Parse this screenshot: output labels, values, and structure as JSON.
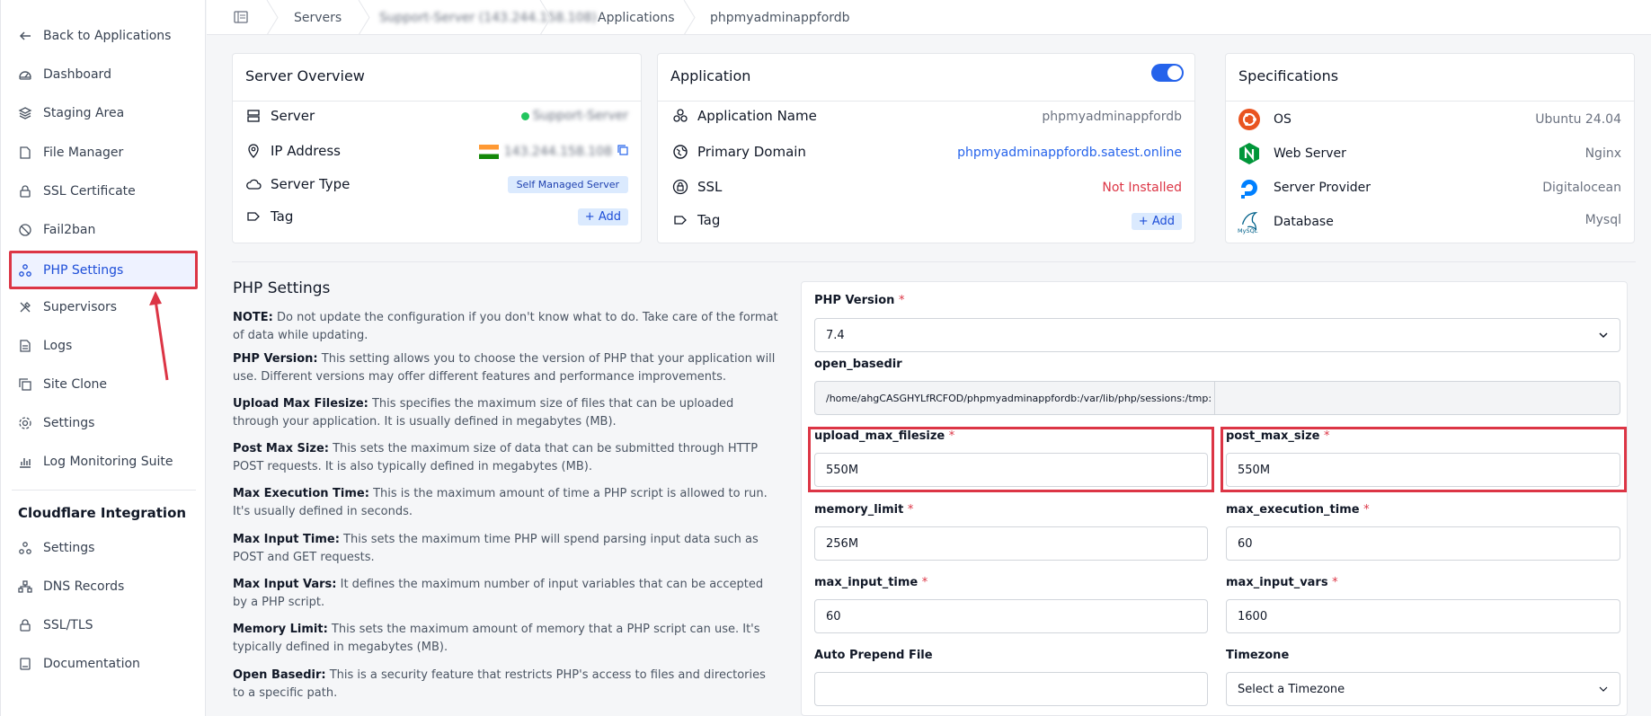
{
  "sidebar": {
    "back": "Back to Applications",
    "items": [
      {
        "label": "Dashboard",
        "icon": "dashboard-icon"
      },
      {
        "label": "Staging Area",
        "icon": "layers-icon"
      },
      {
        "label": "File Manager",
        "icon": "file-icon"
      },
      {
        "label": "SSL Certificate",
        "icon": "lock-icon"
      },
      {
        "label": "Fail2ban",
        "icon": "ban-icon"
      },
      {
        "label": "PHP Settings",
        "icon": "nodes-icon"
      },
      {
        "label": "Supervisors",
        "icon": "tools-icon"
      },
      {
        "label": "Logs",
        "icon": "document-icon"
      },
      {
        "label": "Site Clone",
        "icon": "copy-icon"
      },
      {
        "label": "Settings",
        "icon": "gear-icon"
      },
      {
        "label": "Log Monitoring Suite",
        "icon": "chart-icon"
      }
    ],
    "cloudflare_title": "Cloudflare Integration",
    "cloudflare_items": [
      {
        "label": "Settings",
        "icon": "nodes-icon"
      },
      {
        "label": "DNS Records",
        "icon": "network-icon"
      },
      {
        "label": "SSL/TLS",
        "icon": "lock-icon"
      },
      {
        "label": "Documentation",
        "icon": "book-icon"
      }
    ]
  },
  "breadcrumb": {
    "servers": "Servers",
    "server_name": "Support-Server (143.244.158.108)",
    "applications": "Applications",
    "app": "phpmyadminappfordb"
  },
  "server_overview": {
    "title": "Server Overview",
    "server_label": "Server",
    "server_value": "Support-Server",
    "ip_label": "IP Address",
    "ip_value": "143.244.158.108",
    "type_label": "Server Type",
    "type_value": "Self Managed Server",
    "tag_label": "Tag",
    "add_label": "+ Add"
  },
  "application": {
    "title": "Application",
    "name_label": "Application Name",
    "name_value": "phpmyadminappfordb",
    "domain_label": "Primary Domain",
    "domain_value": "phpmyadminappfordb.satest.online",
    "ssl_label": "SSL",
    "ssl_value": "Not Installed",
    "tag_label": "Tag",
    "add_label": "+ Add"
  },
  "specifications": {
    "title": "Specifications",
    "os_label": "OS",
    "os_value": "Ubuntu 24.04",
    "web_label": "Web Server",
    "web_value": "Nginx",
    "provider_label": "Server Provider",
    "provider_value": "Digitalocean",
    "db_label": "Database",
    "db_value": "Mysql"
  },
  "php": {
    "title": "PHP Settings",
    "descriptions": [
      {
        "key": "NOTE:",
        "text": " Do not update the configuration if you don't know what to do. Take care of the format of data while updating."
      },
      {
        "key": "PHP Version:",
        "text": " This setting allows you to choose the version of PHP that your application will use. Different versions may offer different features and performance improvements."
      },
      {
        "key": "Upload Max Filesize:",
        "text": " This specifies the maximum size of files that can be uploaded through your application. It is usually defined in megabytes (MB)."
      },
      {
        "key": "Post Max Size:",
        "text": " This sets the maximum size of data that can be submitted through HTTP POST requests. It is also typically defined in megabytes (MB)."
      },
      {
        "key": "Max Execution Time:",
        "text": " This is the maximum amount of time a PHP script is allowed to run. It's usually defined in seconds."
      },
      {
        "key": "Max Input Time:",
        "text": " This sets the maximum time PHP will spend parsing input data such as POST and GET requests."
      },
      {
        "key": "Max Input Vars:",
        "text": " It defines the maximum number of input variables that can be accepted by a PHP script."
      },
      {
        "key": "Memory Limit:",
        "text": " This sets the maximum amount of memory that a PHP script can use. It's typically defined in megabytes (MB)."
      },
      {
        "key": "Open Basedir:",
        "text": " This is a security feature that restricts PHP's access to files and directories to a specific path."
      }
    ],
    "form": {
      "php_version_label": "PHP Version",
      "php_version_value": "7.4",
      "open_basedir_label": "open_basedir",
      "open_basedir_value": "/home/ahgCASGHYLfRCFOD/phpmyadminappfordb:/var/lib/php/sessions:/tmp:",
      "upload_label": "upload_max_filesize",
      "upload_value": "550M",
      "post_label": "post_max_size",
      "post_value": "550M",
      "memory_label": "memory_limit",
      "memory_value": "256M",
      "exec_label": "max_execution_time",
      "exec_value": "60",
      "input_time_label": "max_input_time",
      "input_time_value": "60",
      "input_vars_label": "max_input_vars",
      "input_vars_value": "1600",
      "prepend_label": "Auto Prepend File",
      "prepend_value": "",
      "timezone_label": "Timezone",
      "timezone_value": "Select a Timezone",
      "required_mark": "*"
    }
  }
}
